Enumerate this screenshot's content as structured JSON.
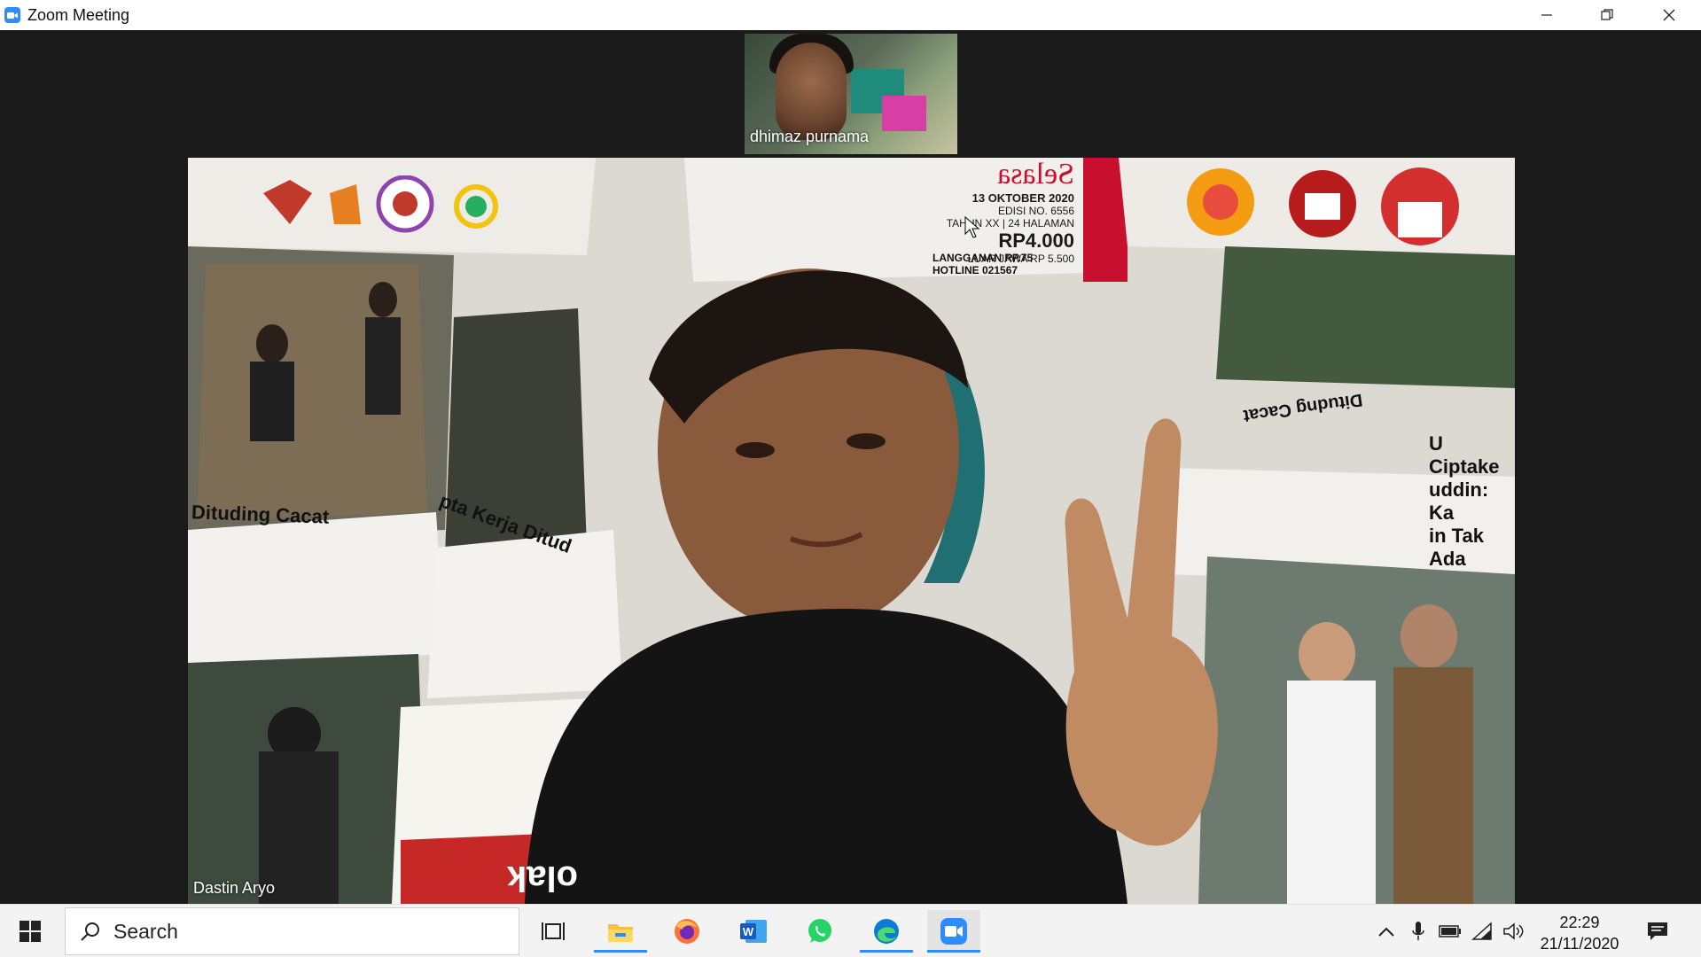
{
  "window": {
    "title": "Zoom Meeting",
    "controls": [
      "minimize-icon",
      "restore-icon",
      "close-icon"
    ]
  },
  "meeting": {
    "thumbnail_participant": {
      "name": "dhimaz purnama"
    },
    "active_speaker": {
      "name": "Dastin Aryo"
    },
    "background_text": {
      "day": "Selasa",
      "date": "13 OKTOBER 2020",
      "edition": "EDISI NO. 6556",
      "year_pages": "TAHUN XX | 24 HALAMAN",
      "price": "RP4.000",
      "price_outside": "LUAR JAWA RP 5.500",
      "subscription": "LANGGANAN RP.75",
      "hotline": "HOTLINE 021567",
      "headline_1": "Dituding Cacat",
      "headline_2": "pta Kerja Ditud",
      "headline_3": "U Ciptake",
      "headline_4": "uddin: Ka",
      "headline_5": "in Tak Ada",
      "headline_6": "Ditudng Cacat",
      "red_text": "olak"
    }
  },
  "taskbar": {
    "search_placeholder": "Search",
    "apps": [
      "task-view-icon",
      "file-explorer-icon",
      "firefox-icon",
      "word-icon",
      "whatsapp-icon",
      "edge-icon",
      "zoom-icon"
    ],
    "active_app": "zoom-icon",
    "tray": [
      "chevron-up-icon",
      "microphone-icon",
      "battery-icon",
      "wifi-icon",
      "volume-icon"
    ],
    "time": "22:29",
    "date": "21/11/2020"
  },
  "colors": {
    "zoom_blue": "#2d8cff",
    "meeting_bg": "#1a1a1a",
    "taskbar_bg": "#f3f3f3"
  }
}
